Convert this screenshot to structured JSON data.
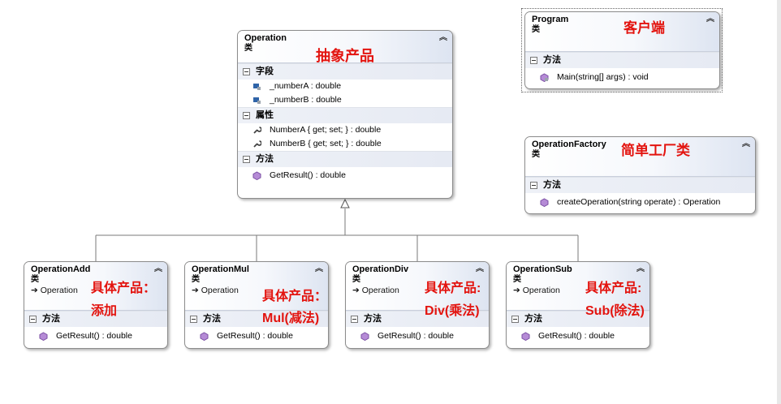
{
  "operation": {
    "name": "Operation",
    "kind": "类",
    "label": "抽象产品",
    "fields_title": "字段",
    "fields": [
      "_numberA : double",
      "_numberB : double"
    ],
    "props_title": "属性",
    "props": [
      "NumberA { get; set; } : double",
      "NumberB { get; set; } : double"
    ],
    "methods_title": "方法",
    "methods": [
      "GetResult() : double"
    ]
  },
  "program": {
    "name": "Program",
    "kind": "类",
    "label": "客户端",
    "methods_title": "方法",
    "methods": [
      "Main(string[] args) : void"
    ]
  },
  "factory": {
    "name": "OperationFactory",
    "kind": "类",
    "label": "简单工厂类",
    "methods_title": "方法",
    "methods": [
      "createOperation(string operate) : Operation"
    ]
  },
  "subclasses": [
    {
      "name": "OperationAdd",
      "kind": "类",
      "base": "Operation",
      "methods_title": "方法",
      "method": "GetResult() : double",
      "label1": "具体产品：",
      "label2": "添加"
    },
    {
      "name": "OperationMul",
      "kind": "类",
      "base": "Operation",
      "methods_title": "方法",
      "method": "GetResult() : double",
      "label1": "具体产品：",
      "label2": "Mul(减法)"
    },
    {
      "name": "OperationDiv",
      "kind": "类",
      "base": "Operation",
      "methods_title": "方法",
      "method": "GetResult() : double",
      "label1": "具体产品:",
      "label2": "Div(乘法)"
    },
    {
      "name": "OperationSub",
      "kind": "类",
      "base": "Operation",
      "methods_title": "方法",
      "method": "GetResult() : double",
      "label1": "具体产品:",
      "label2": "Sub(除法)"
    }
  ],
  "icons": {
    "collapse": "double-chevron-up-icon",
    "field": "field-icon",
    "property": "wrench-icon",
    "method": "method-cube-icon",
    "inherit": "inherit-arrow-icon"
  },
  "colors": {
    "label_red": "#e3140f",
    "method_purple": "#7a4fa3",
    "field_blue": "#2f64a8"
  }
}
